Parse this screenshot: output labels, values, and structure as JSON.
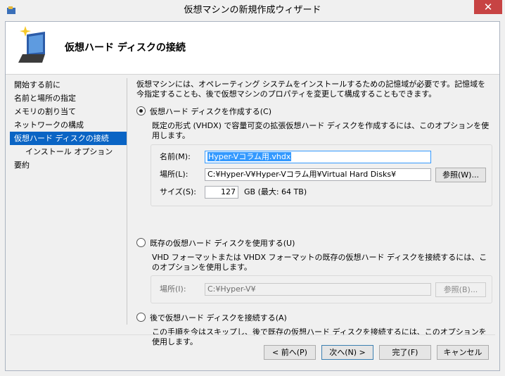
{
  "window": {
    "title": "仮想マシンの新規作成ウィザード",
    "close_glyph": "✕"
  },
  "header": {
    "title": "仮想ハード ディスクの接続"
  },
  "nav": {
    "items": [
      {
        "label": "開始する前に"
      },
      {
        "label": "名前と場所の指定"
      },
      {
        "label": "メモリの割り当て"
      },
      {
        "label": "ネットワークの構成"
      },
      {
        "label": "仮想ハード ディスクの接続",
        "active": true
      },
      {
        "label": "インストール オプション",
        "sub": true
      },
      {
        "label": "要約"
      }
    ]
  },
  "intro": "仮想マシンには、オペレーティング システムをインストールするための記憶域が必要です。記憶域を今指定することも、後で仮想マシンのプロパティを変更して構成することもできます。",
  "option_create": {
    "label": "仮想ハード ディスクを作成する(C)",
    "desc": "既定の形式 (VHDX) で容量可変の拡張仮想ハード ディスクを作成するには、このオプションを使用します。",
    "name_label": "名前(M):",
    "name_value": "Hyper-Vコラム用.vhdx",
    "location_label": "場所(L):",
    "location_value": "C:¥Hyper-V¥Hyper-Vコラム用¥Virtual Hard Disks¥",
    "browse_label": "参照(W)...",
    "size_label": "サイズ(S):",
    "size_value": "127",
    "size_unit": "GB (最大: 64 TB)"
  },
  "option_existing": {
    "label": "既存の仮想ハード ディスクを使用する(U)",
    "desc": "VHD フォーマットまたは VHDX フォーマットの既存の仮想ハード ディスクを接続するには、このオプションを使用します。",
    "location_label": "場所(I):",
    "location_value": "C:¥Hyper-V¥",
    "browse_label": "参照(B)..."
  },
  "option_later": {
    "label": "後で仮想ハード ディスクを接続する(A)",
    "desc": "この手順を今はスキップし、後で既存の仮想ハード ディスクを接続するには、このオプションを使用します。"
  },
  "buttons": {
    "back": "< 前へ(P)",
    "next": "次へ(N) >",
    "finish": "完了(F)",
    "cancel": "キャンセル"
  }
}
